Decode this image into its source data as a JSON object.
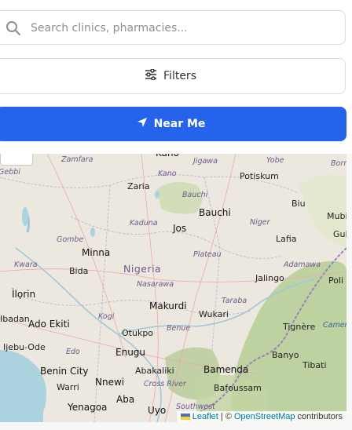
{
  "search": {
    "placeholder": "Search clinics, pharmacies..."
  },
  "filters": {
    "label": "Filters"
  },
  "near_me": {
    "label": "Near Me"
  },
  "map": {
    "places": [
      {
        "name": "Zamfara",
        "kind": "state"
      },
      {
        "name": "Kano",
        "kind": "state"
      },
      {
        "name": "Jigawa",
        "kind": "state"
      },
      {
        "name": "Yobe",
        "kind": "state"
      },
      {
        "name": "Potiskum",
        "kind": "city"
      },
      {
        "name": "Zaria",
        "kind": "city"
      },
      {
        "name": "Bauchi",
        "kind": "state"
      },
      {
        "name": "Bauchi",
        "kind": "city"
      },
      {
        "name": "Biu",
        "kind": "city"
      },
      {
        "name": "Mubi",
        "kind": "city"
      },
      {
        "name": "Kaduna",
        "kind": "state"
      },
      {
        "name": "Jos",
        "kind": "city"
      },
      {
        "name": "Niger",
        "kind": "state"
      },
      {
        "name": "Gombe",
        "kind": "state"
      },
      {
        "name": "Lafia",
        "kind": "city"
      },
      {
        "name": "Minna",
        "kind": "city"
      },
      {
        "name": "Plateau",
        "kind": "state"
      },
      {
        "name": "Adamawa",
        "kind": "state"
      },
      {
        "name": "Kwara",
        "kind": "state"
      },
      {
        "name": "Bida",
        "kind": "city"
      },
      {
        "name": "Nigeria",
        "kind": "country"
      },
      {
        "name": "Jalingo",
        "kind": "city"
      },
      {
        "name": "Poli",
        "kind": "city"
      },
      {
        "name": "Nasarawa",
        "kind": "state"
      },
      {
        "name": "Ìlọrin",
        "kind": "city"
      },
      {
        "name": "Makurdi",
        "kind": "city"
      },
      {
        "name": "Taraba",
        "kind": "state"
      },
      {
        "name": "Kogi",
        "kind": "state"
      },
      {
        "name": "Wukari",
        "kind": "city"
      },
      {
        "name": "Ado Ekiti",
        "kind": "city"
      },
      {
        "name": "Benue",
        "kind": "state"
      },
      {
        "name": "Tignère",
        "kind": "city"
      },
      {
        "name": "Otukpo",
        "kind": "city"
      },
      {
        "name": "Ijebu-Ode",
        "kind": "city"
      },
      {
        "name": "Edo",
        "kind": "state"
      },
      {
        "name": "Enugu",
        "kind": "city"
      },
      {
        "name": "Banyo",
        "kind": "city"
      },
      {
        "name": "Benin City",
        "kind": "city"
      },
      {
        "name": "Abakaliki",
        "kind": "city"
      },
      {
        "name": "Bamenda",
        "kind": "city"
      },
      {
        "name": "Tibati",
        "kind": "city"
      },
      {
        "name": "Warri",
        "kind": "city"
      },
      {
        "name": "Nnewi",
        "kind": "city"
      },
      {
        "name": "Cross River",
        "kind": "state"
      },
      {
        "name": "Bafoussam",
        "kind": "city"
      },
      {
        "name": "Aba",
        "kind": "city"
      },
      {
        "name": "Yenagoa",
        "kind": "city"
      },
      {
        "name": "Uyo",
        "kind": "city"
      },
      {
        "name": "Southwest",
        "kind": "state"
      },
      {
        "name": "Borno",
        "kind": "state"
      },
      {
        "name": "Guider",
        "kind": "city"
      },
      {
        "name": "Cameroun",
        "kind": "state"
      },
      {
        "name": "Ibadan",
        "kind": "city"
      },
      {
        "name": "Gebbi",
        "kind": "state"
      }
    ],
    "attribution": {
      "leaflet": "Leaflet",
      "separator": "| ©",
      "osm": "OpenStreetMap",
      "suffix": "contributors"
    }
  },
  "colors": {
    "primary": "#2563eb",
    "land": "#ece8df",
    "water": "#aad3df"
  }
}
